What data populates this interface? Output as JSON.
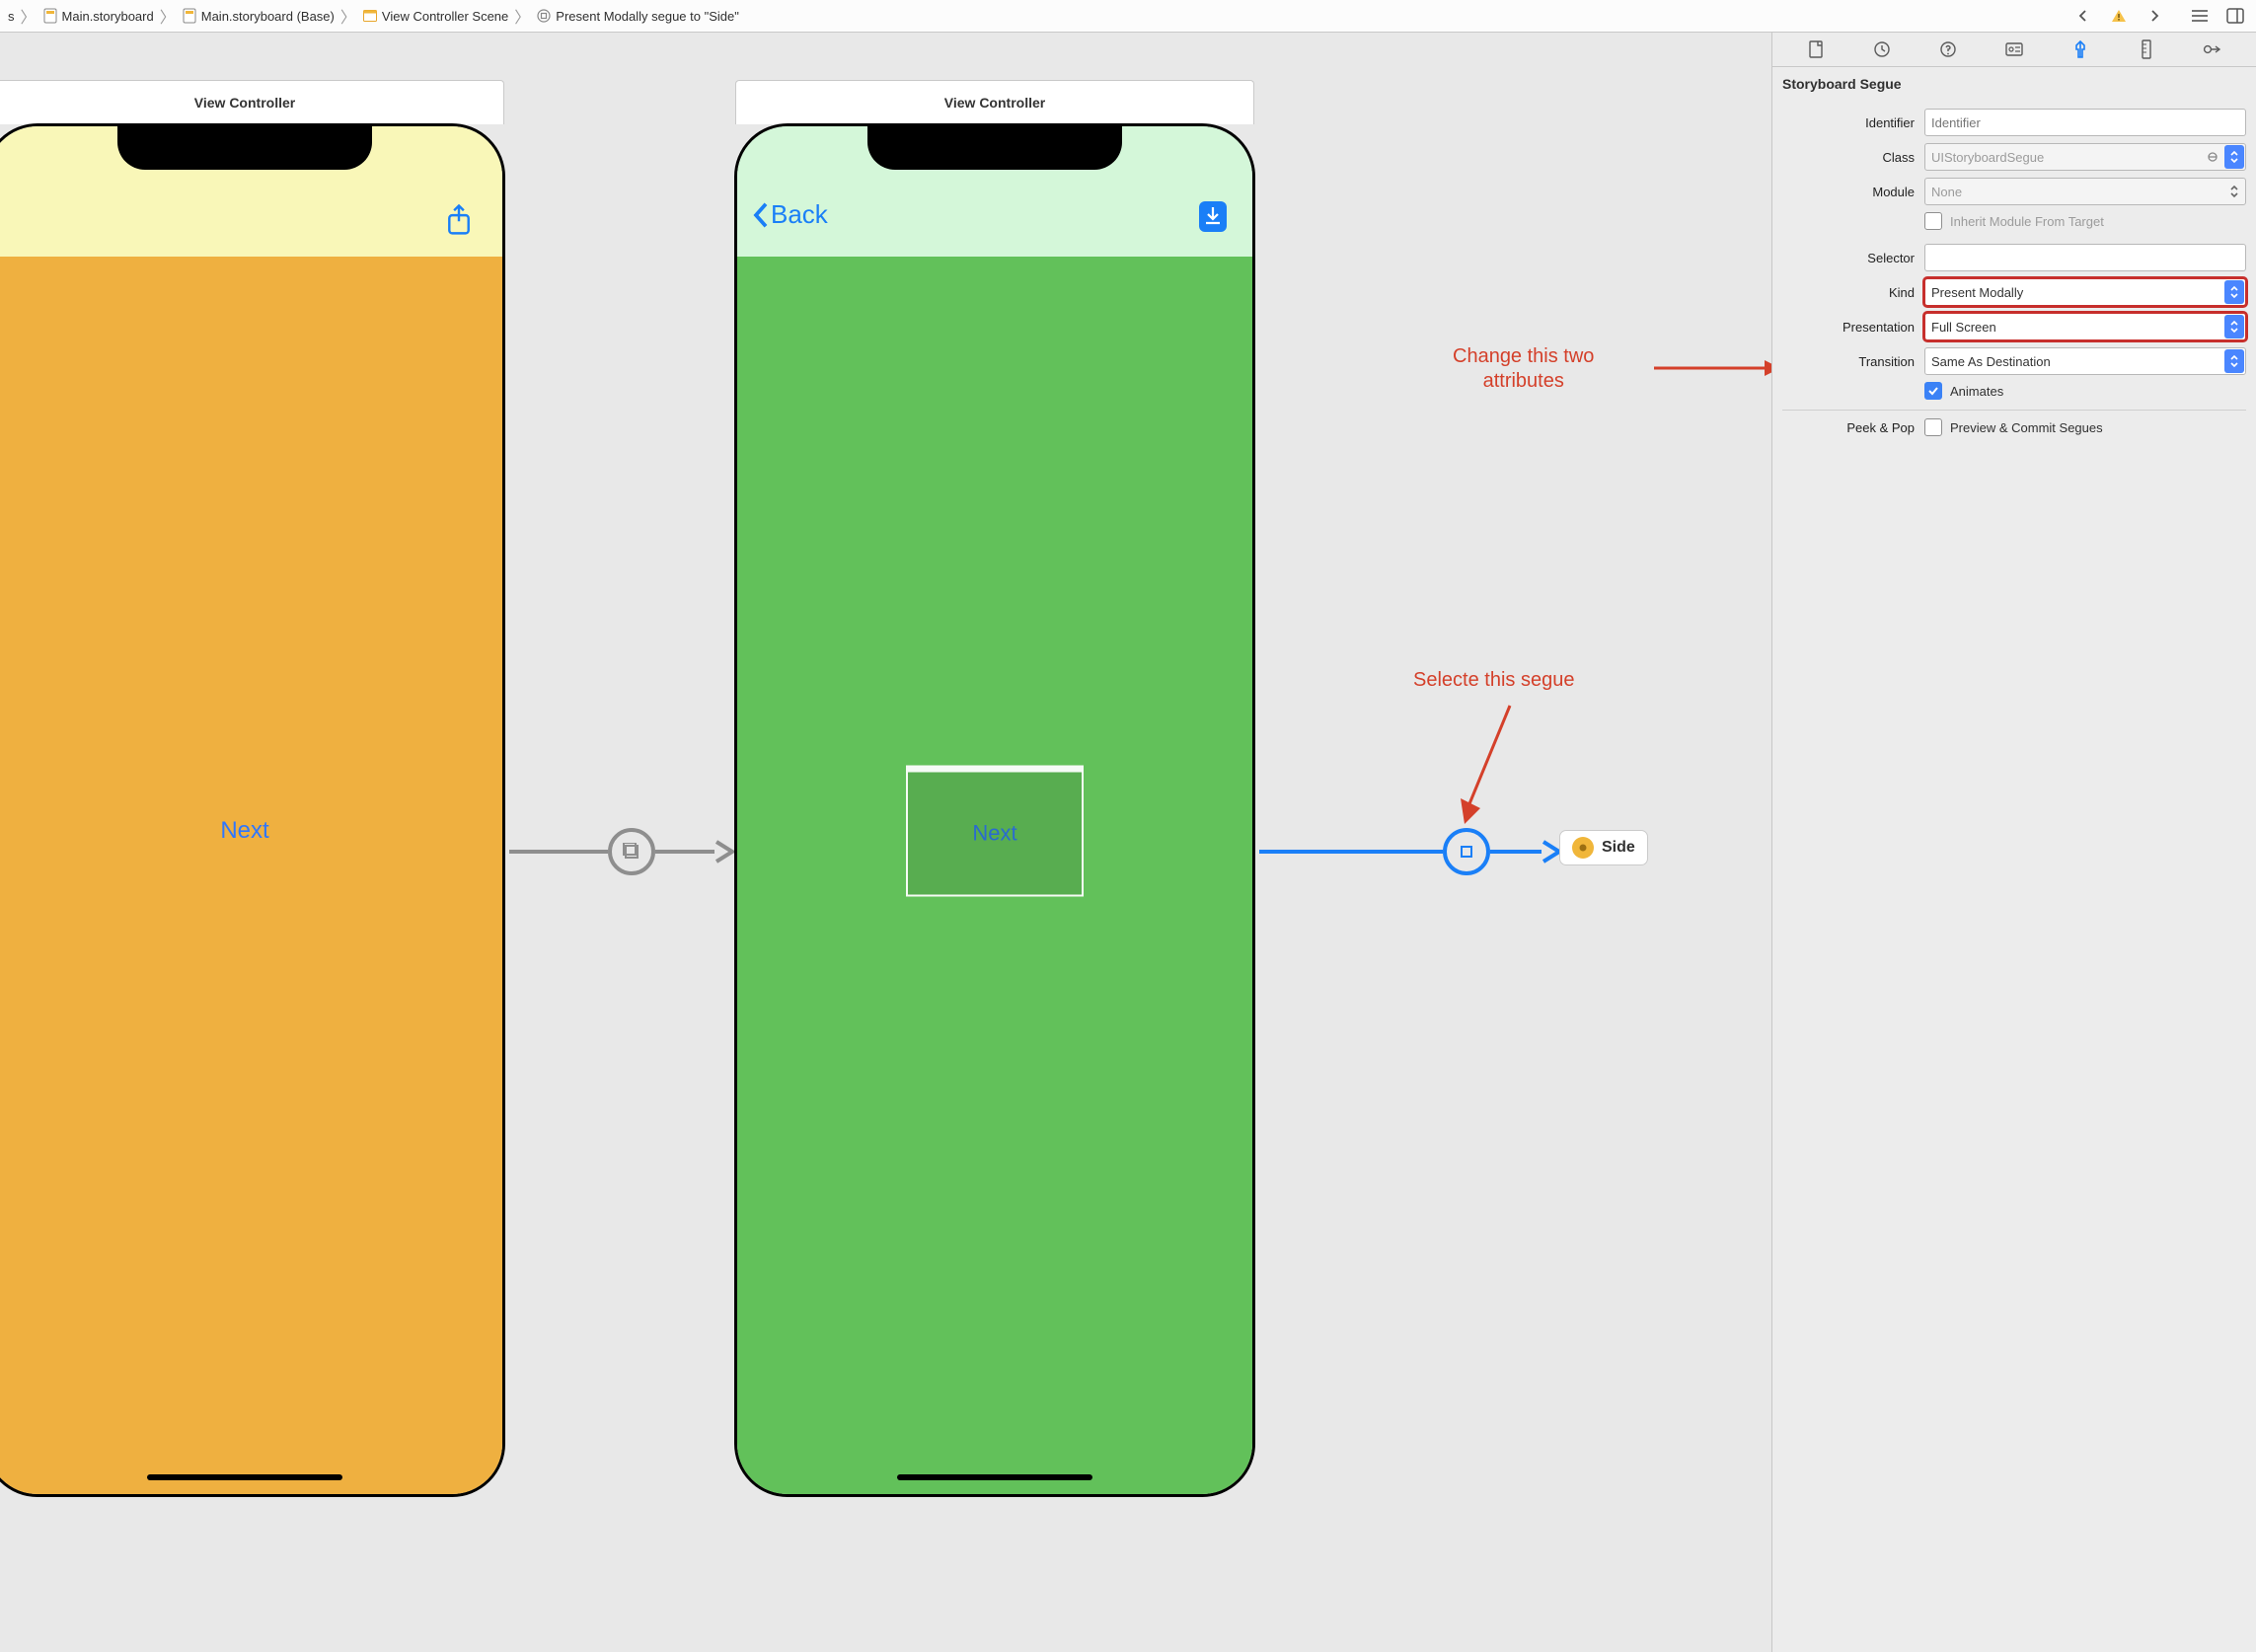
{
  "breadcrumbs": {
    "item0_suffix": "s",
    "item1": "Main.storyboard",
    "item2": "Main.storyboard (Base)",
    "item3": "View Controller Scene",
    "item4": "Present Modally segue to \"Side\""
  },
  "canvas": {
    "phone1_title": "View Controller",
    "phone2_title": "View Controller",
    "phone1_center_btn": "Next",
    "phone2_back_label": "Back",
    "phone2_container_label": "Next",
    "side_chip_label": "Side"
  },
  "annotations": {
    "change_two_line1": "Change this two",
    "change_two_line2": "attributes",
    "select_segue": "Selecte this segue"
  },
  "inspector": {
    "section_title": "Storyboard Segue",
    "identifier_label": "Identifier",
    "identifier_placeholder": "Identifier",
    "class_label": "Class",
    "class_value": "UIStoryboardSegue",
    "module_label": "Module",
    "module_value": "None",
    "inherit_label": "Inherit Module From Target",
    "selector_label": "Selector",
    "selector_value": "",
    "kind_label": "Kind",
    "kind_value": "Present Modally",
    "presentation_label": "Presentation",
    "presentation_value": "Full Screen",
    "transition_label": "Transition",
    "transition_value": "Same As Destination",
    "animates_label": "Animates",
    "peekpop_label": "Peek & Pop",
    "peekpop_value": "Preview & Commit Segues"
  }
}
